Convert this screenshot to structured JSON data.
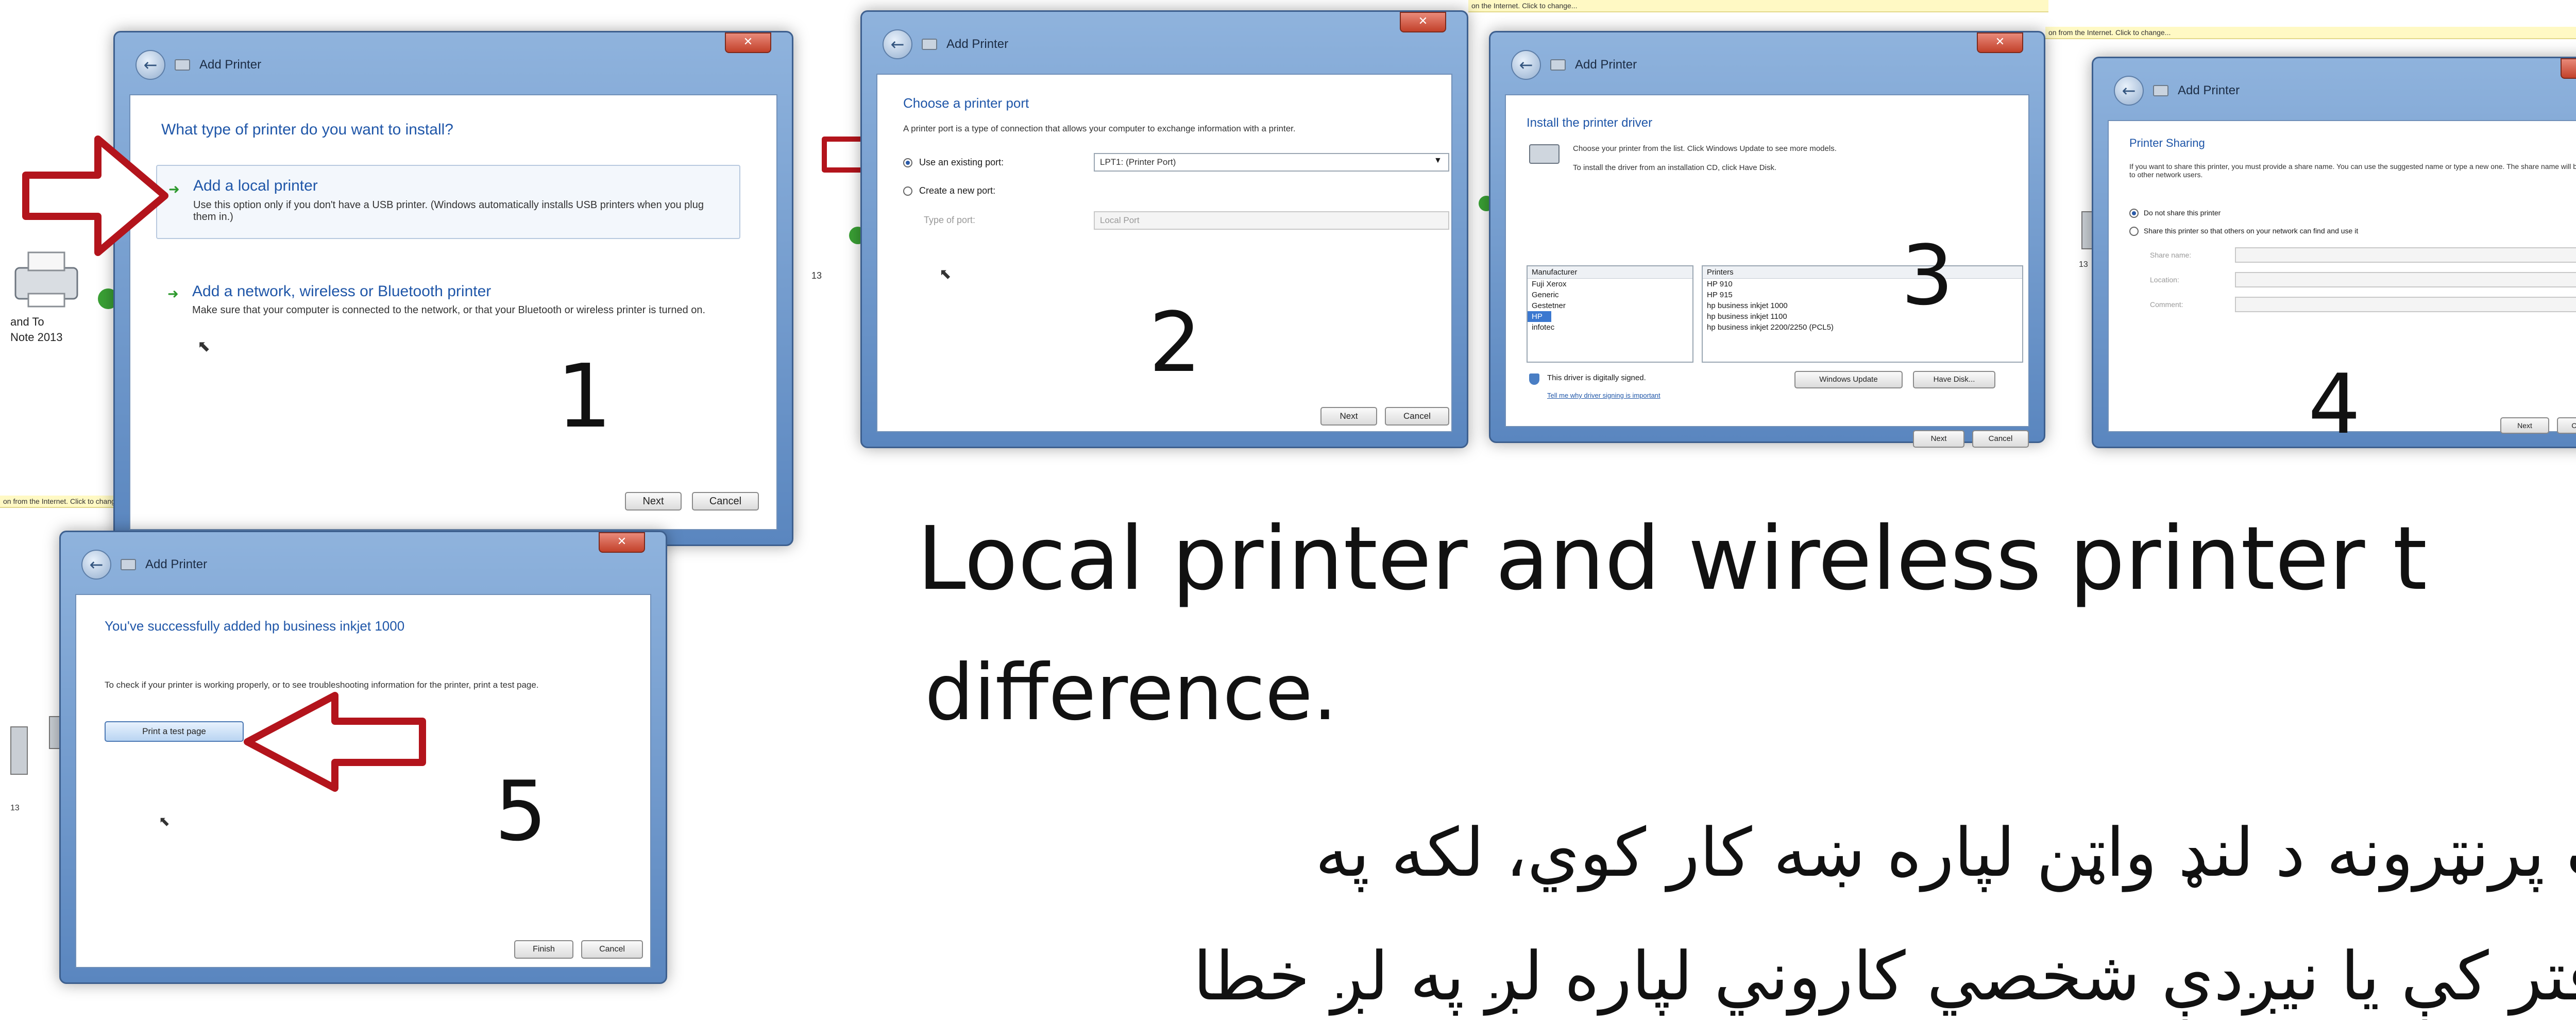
{
  "colors": {
    "accent_blue": "#1f56a8",
    "arrow_red": "#b3141c",
    "titlebar_blue": "#6f96c8"
  },
  "strip_top": "on the Internet. Click to change...",
  "strip_top_right": "on from the Internet. Click to change...",
  "strip_left": "on from the Internet. Click to change...",
  "desktop_left": {
    "line1": "and To",
    "line2": "Note 2013"
  },
  "desktop_side_label": "13",
  "step1": {
    "title": "Add Printer",
    "question": "What type of printer do you want to install?",
    "option1_title": "Add a local printer",
    "option1_desc": "Use this option only if you don't have a USB printer. (Windows automatically installs USB printers when you plug them in.)",
    "option2_title": "Add a network, wireless or Bluetooth printer",
    "option2_desc": "Make sure that your computer is connected to the network, or that your Bluetooth or wireless printer is turned on.",
    "next": "Next",
    "cancel": "Cancel",
    "number": "1"
  },
  "step2": {
    "title": "Add Printer",
    "heading": "Choose a printer port",
    "desc": "A printer port is a type of connection that allows your computer to exchange information with a printer.",
    "use_existing": "Use an existing port:",
    "existing_value": "LPT1: (Printer Port)",
    "create_new": "Create a new port:",
    "type_label": "Type of port:",
    "type_value": "Local Port",
    "next": "Next",
    "cancel": "Cancel",
    "number": "2"
  },
  "step3": {
    "title": "Add Printer",
    "heading": "Install the printer driver",
    "desc1": "Choose your printer from the list. Click Windows Update to see more models.",
    "desc2": "To install the driver from an installation CD, click Have Disk.",
    "manufacturer_header": "Manufacturer",
    "printers_header": "Printers",
    "manufacturers": [
      "Fuji Xerox",
      "Generic",
      "Gestetner",
      "HP",
      "infotec"
    ],
    "printers": [
      "HP 910",
      "HP 915",
      "hp business inkjet 1000",
      "hp business inkjet 1100",
      "hp business inkjet 2200/2250 (PCL5)"
    ],
    "signed": "This driver is digitally signed.",
    "signing_link": "Tell me why driver signing is important",
    "windows_update": "Windows Update",
    "have_disk": "Have Disk...",
    "next": "Next",
    "cancel": "Cancel",
    "number": "3"
  },
  "step4": {
    "title": "Add Printer",
    "heading": "Printer Sharing",
    "desc": "If you want to share this printer, you must provide a share name. You can use the suggested name or type a new one. The share name will be visible to other network users.",
    "no_share": "Do not share this printer",
    "share": "Share this printer so that others on your network can find and use it",
    "share_name": "Share name:",
    "location": "Location:",
    "comment": "Comment:",
    "next": "Next",
    "cancel": "Cancel",
    "number": "4"
  },
  "step5": {
    "title": "Add Printer",
    "heading": "You've successfully added hp business inkjet 1000",
    "desc": "To check if your printer is working properly, or to see troubleshooting information for the printer, print a test page.",
    "print_test": "Print a test page",
    "finish": "Finish",
    "cancel": "Cancel",
    "number": "5"
  },
  "caption": {
    "english_line1": "Local printer and wireless printer t",
    "english_line2": "difference.",
    "pashto_line1": "ټ پرنټرونه د لنډ واټن لپاره ښه کار کوي، لکه په",
    "pashto_line2": "دفتر کې یا نیږدې شخصي کاروني لپاره لږ په لږ خطا"
  }
}
